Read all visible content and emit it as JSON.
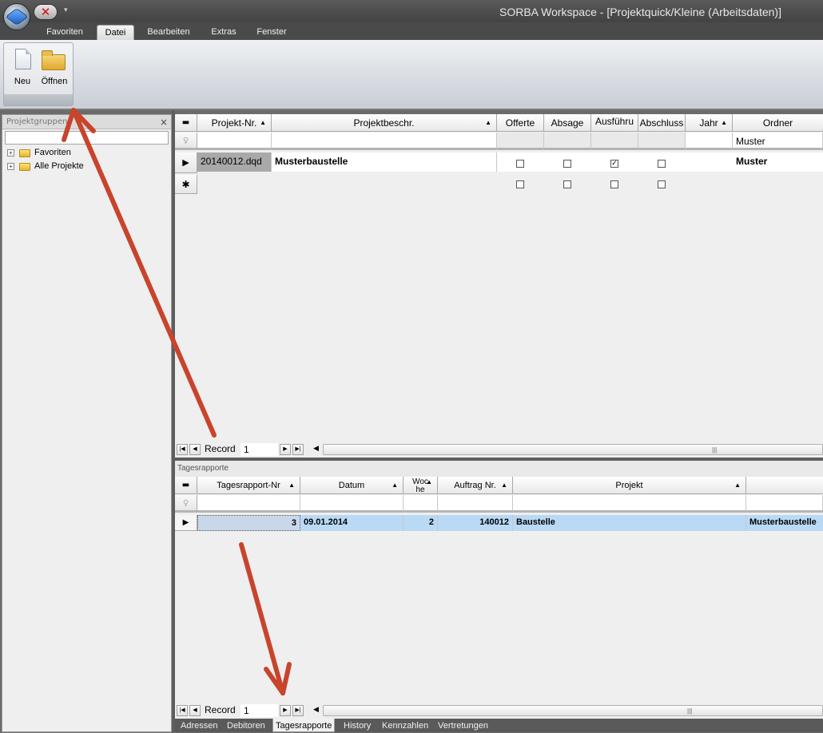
{
  "window": {
    "title": "SORBA Workspace - [Projektquick/Kleine (Arbeitsdaten)]"
  },
  "ribbon": {
    "tabs": [
      "Favoriten",
      "Datei",
      "Bearbeiten",
      "Extras",
      "Fenster"
    ],
    "active_tab": "Datei",
    "buttons": {
      "new": "Neu",
      "open": "Öffnen"
    }
  },
  "left_pane": {
    "title": "Projektgruppen",
    "close": "×",
    "tree": [
      {
        "label": "Favoriten"
      },
      {
        "label": "Alle Projekte"
      }
    ]
  },
  "projects_grid": {
    "columns": [
      "Projekt-Nr.",
      "Projektbeschr.",
      "Offerte",
      "Absage",
      "Ausführu",
      "Abschluss",
      "Jahr",
      "Ordner"
    ],
    "filter_row": {
      "ordner": "Muster"
    },
    "rows": [
      {
        "projekt_nr": "20140012.dqd",
        "beschr": "Musterbaustelle",
        "offerte": false,
        "absage": false,
        "ausfuehrung": true,
        "abschluss": false,
        "jahr": "",
        "ordner": "Muster"
      }
    ],
    "navigator": {
      "label": "Record",
      "value": "1"
    }
  },
  "rapporte_grid": {
    "title": "Tagesrapporte",
    "columns": [
      "Tagesrapport-Nr",
      "Datum",
      "Woche",
      "Auftrag Nr.",
      "Projekt",
      ""
    ],
    "rows": [
      {
        "nr": "3",
        "datum": "09.01.2014",
        "woche": "2",
        "auftrag": "140012",
        "projekt": "Baustelle",
        "extra": "Musterbaustelle"
      }
    ],
    "navigator": {
      "label": "Record",
      "value": "1"
    }
  },
  "bottom_tabs": [
    "Adressen",
    "Debitoren",
    "Tagesrapporte",
    "History",
    "Kennzahlen",
    "Vertretungen"
  ],
  "active_bottom_tab": "Tagesrapporte",
  "colors": {
    "annotation_arrow": "#c8442c",
    "selection": "#b9d9f5"
  }
}
